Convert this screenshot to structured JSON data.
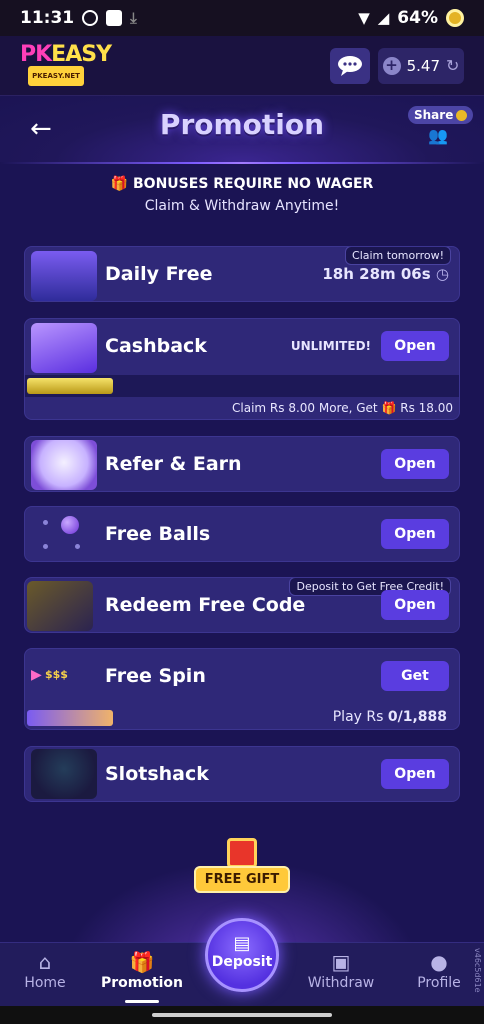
{
  "status_bar": {
    "time": "11:31",
    "battery": "64%"
  },
  "app": {
    "logo_main": [
      "PK",
      "EASY"
    ],
    "logo_sub": "PKEASY.NET",
    "balance": "5.47"
  },
  "header": {
    "title": "Promotion",
    "share_label": "Share"
  },
  "notice": {
    "line1": "BONUSES REQUIRE NO WAGER",
    "line2": "Claim & Withdraw Anytime!"
  },
  "cards": {
    "daily_free": {
      "name": "Daily Free",
      "tag": "Claim tomorrow!",
      "timer": "18h 28m 06s"
    },
    "cashback": {
      "name": "Cashback",
      "badge": "UNLIMITED!",
      "button": "Open",
      "note": "Claim Rs 8.00 More, Get",
      "reward": "Rs 18.00",
      "progress": 0.2
    },
    "refer": {
      "name": "Refer & Earn",
      "button": "Open"
    },
    "free_balls": {
      "name": "Free Balls",
      "button": "Open"
    },
    "redeem": {
      "name": "Redeem Free Code",
      "button": "Open",
      "tag": "Deposit to Get Free Credit!"
    },
    "free_spin": {
      "name": "Free Spin",
      "button": "Get",
      "play_label": "Play Rs",
      "play_value": "0/1,888",
      "pic_text": "$$$",
      "progress": 0.2
    },
    "slotshack": {
      "name": "Slotshack",
      "button": "Open"
    }
  },
  "free_gift": {
    "label": "FREE GIFT"
  },
  "nav": {
    "home": "Home",
    "promotion": "Promotion",
    "deposit": "Deposit",
    "withdraw": "Withdraw",
    "profile": "Profile"
  },
  "version": "v46c5d61e"
}
